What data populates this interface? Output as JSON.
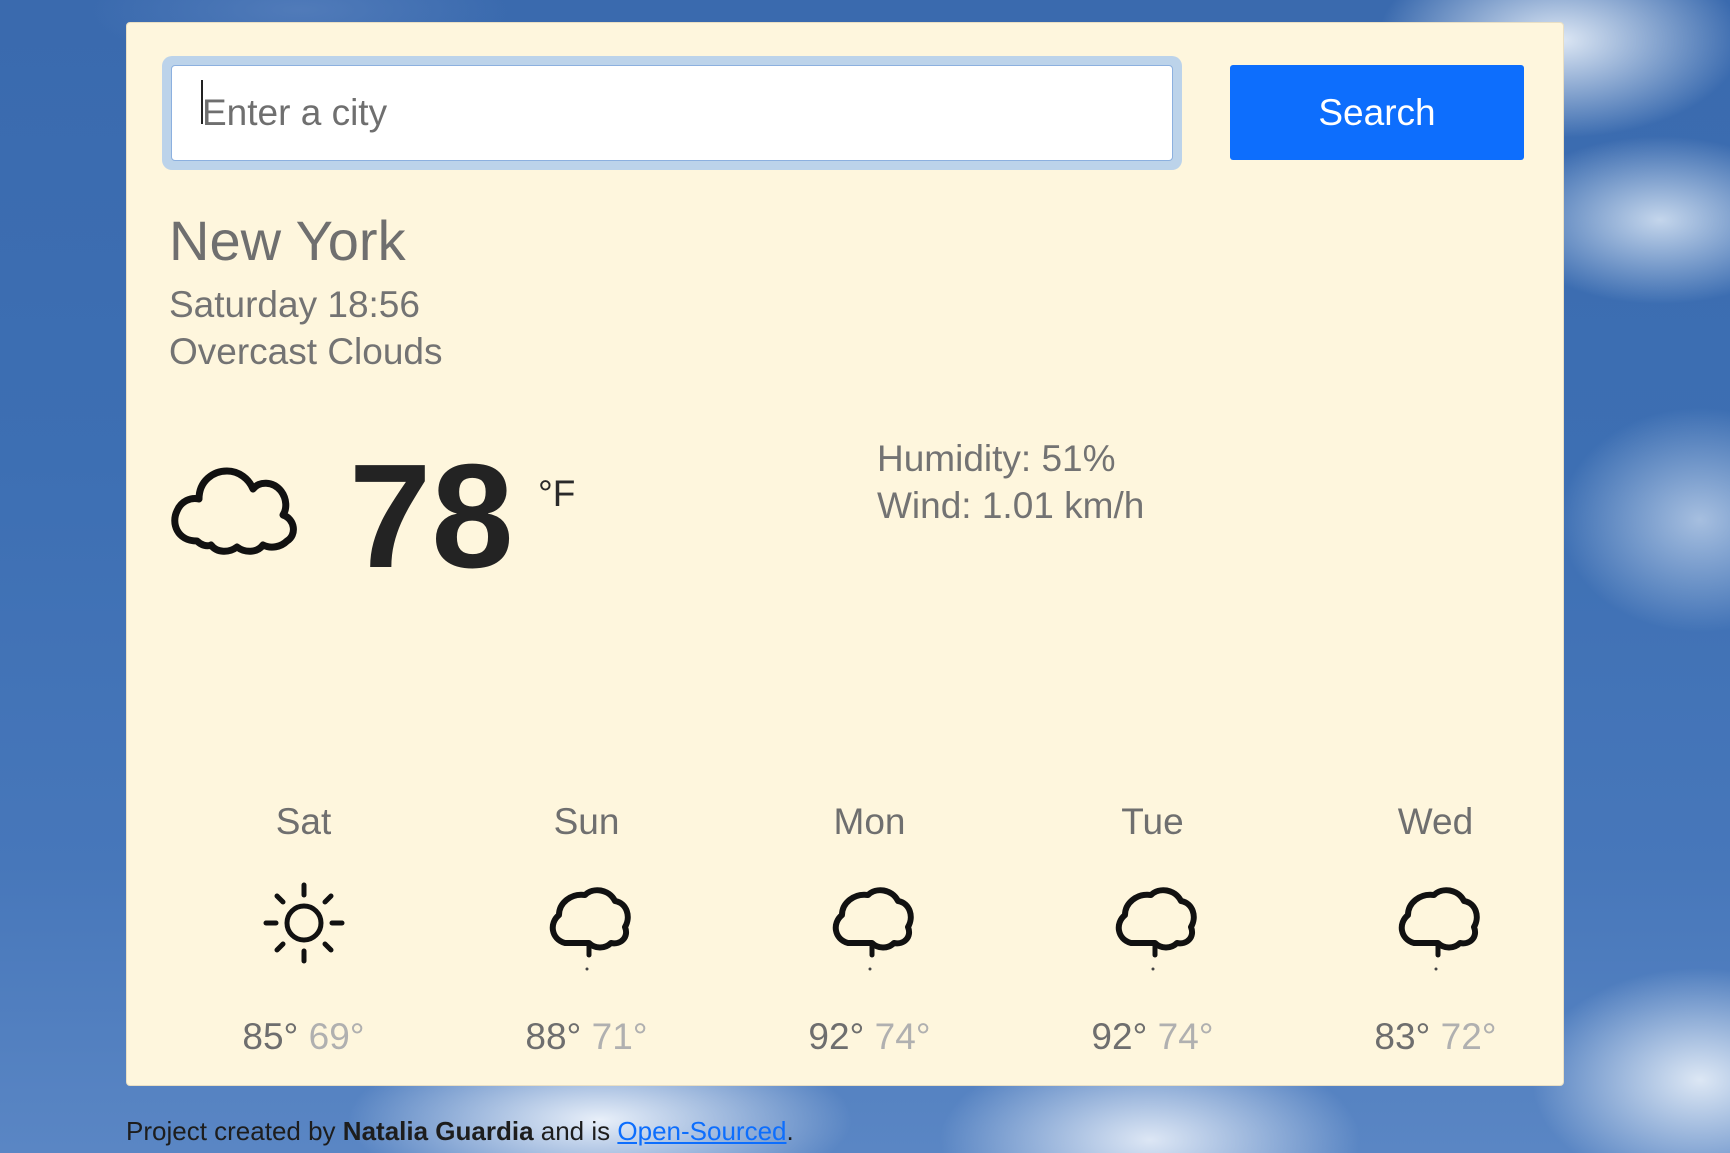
{
  "search": {
    "placeholder": "Enter a city",
    "value": "",
    "button_label": "Search"
  },
  "current": {
    "city": "New York",
    "datetime": "Saturday 18:56",
    "description": "Overcast Clouds",
    "temperature": "78",
    "unit": "°F",
    "icon": "cloud-icon",
    "humidity": "Humidity: 51%",
    "wind": "Wind: 1.01 km/h"
  },
  "forecast": [
    {
      "day": "Sat",
      "icon": "sun-icon",
      "max": "85°",
      "min": "69°"
    },
    {
      "day": "Sun",
      "icon": "rain-cloud-icon",
      "max": "88°",
      "min": "71°"
    },
    {
      "day": "Mon",
      "icon": "rain-cloud-icon",
      "max": "92°",
      "min": "74°"
    },
    {
      "day": "Tue",
      "icon": "rain-cloud-icon",
      "max": "92°",
      "min": "74°"
    },
    {
      "day": "Wed",
      "icon": "rain-cloud-icon",
      "max": "83°",
      "min": "72°"
    }
  ],
  "footer": {
    "prefix": "Project created by",
    "author": "Natalia Guardia",
    "middle": "and is",
    "link": "Open-Sourced",
    "suffix": "."
  },
  "colors": {
    "card_background": "#fef6dd",
    "button": "#0d6efd",
    "temperature_text": "#232323",
    "muted_text": "#737373",
    "min_temp_text": "#b0b0b0"
  }
}
